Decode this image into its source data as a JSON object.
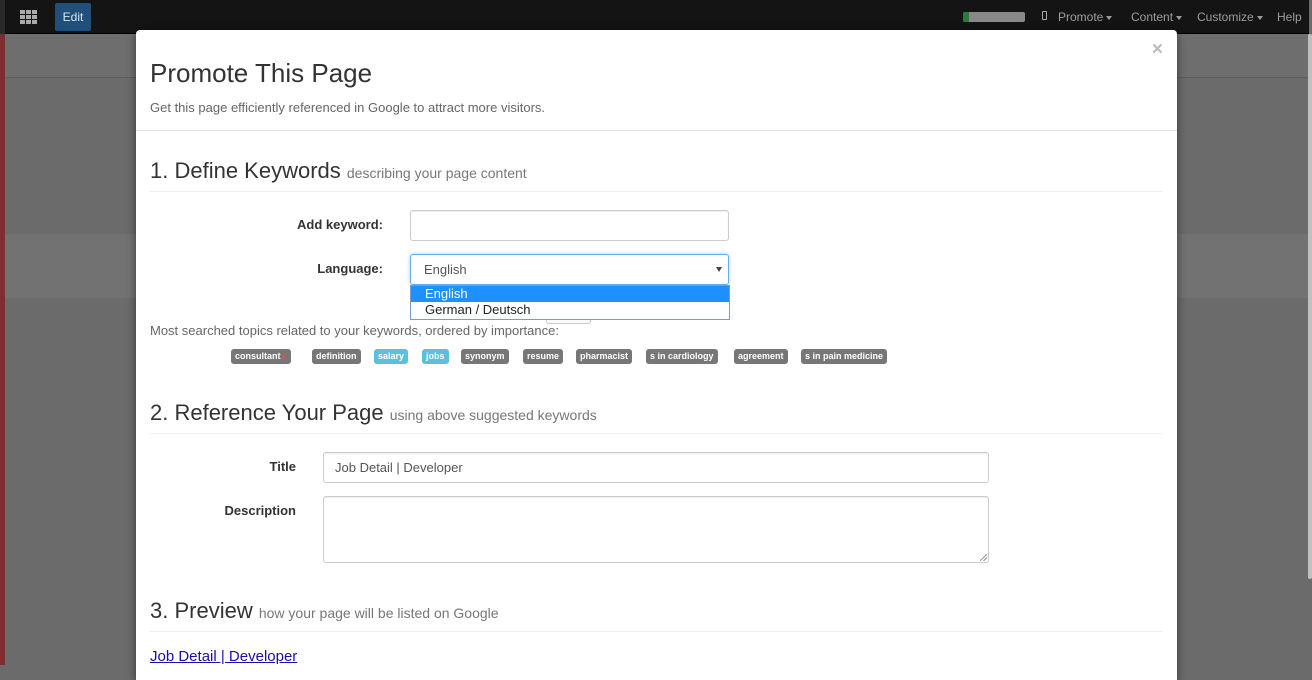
{
  "navbar": {
    "edit_label": "Edit",
    "menus": [
      "Promote",
      "Content",
      "Customize",
      "Help"
    ],
    "progress": 0.1
  },
  "modal": {
    "close_glyph": "×",
    "title": "Promote This Page",
    "subtitle": "Get this page efficiently referenced in Google to attract more visitors."
  },
  "section1": {
    "heading": "1. Define Keywords",
    "subheading": "describing your page content",
    "add_keyword_label": "Add keyword:",
    "add_keyword_value": "",
    "language_label": "Language:",
    "language_value": "English",
    "language_options": [
      "English",
      "German / Deutsch"
    ],
    "topics_text": "Most searched topics related to your keywords, ordered by importance:",
    "tags": [
      {
        "label": "consultant",
        "removable": true,
        "style": "default"
      },
      {
        "label": "definition",
        "style": "default"
      },
      {
        "label": "salary",
        "style": "info"
      },
      {
        "label": "jobs",
        "style": "info"
      },
      {
        "label": "synonym",
        "style": "default"
      },
      {
        "label": "resume",
        "style": "default"
      },
      {
        "label": "pharmacist",
        "style": "default"
      },
      {
        "label": "s in cardiology",
        "style": "default"
      },
      {
        "label": "agreement",
        "style": "default"
      },
      {
        "label": "s in pain medicine",
        "style": "default"
      }
    ],
    "remove_glyph": "x"
  },
  "section2": {
    "heading": "2. Reference Your Page",
    "subheading": "using above suggested keywords",
    "title_label": "Title",
    "title_value": "Job Detail | Developer",
    "description_label": "Description",
    "description_value": ""
  },
  "section3": {
    "heading": "3. Preview",
    "subheading": "how your page will be listed on Google",
    "preview_link": "Job Detail | Developer"
  },
  "colors": {
    "tag_default": "#777777",
    "tag_info": "#5bc0de",
    "dropdown_selected": "#1e90ff",
    "link": "#1a0dab"
  }
}
